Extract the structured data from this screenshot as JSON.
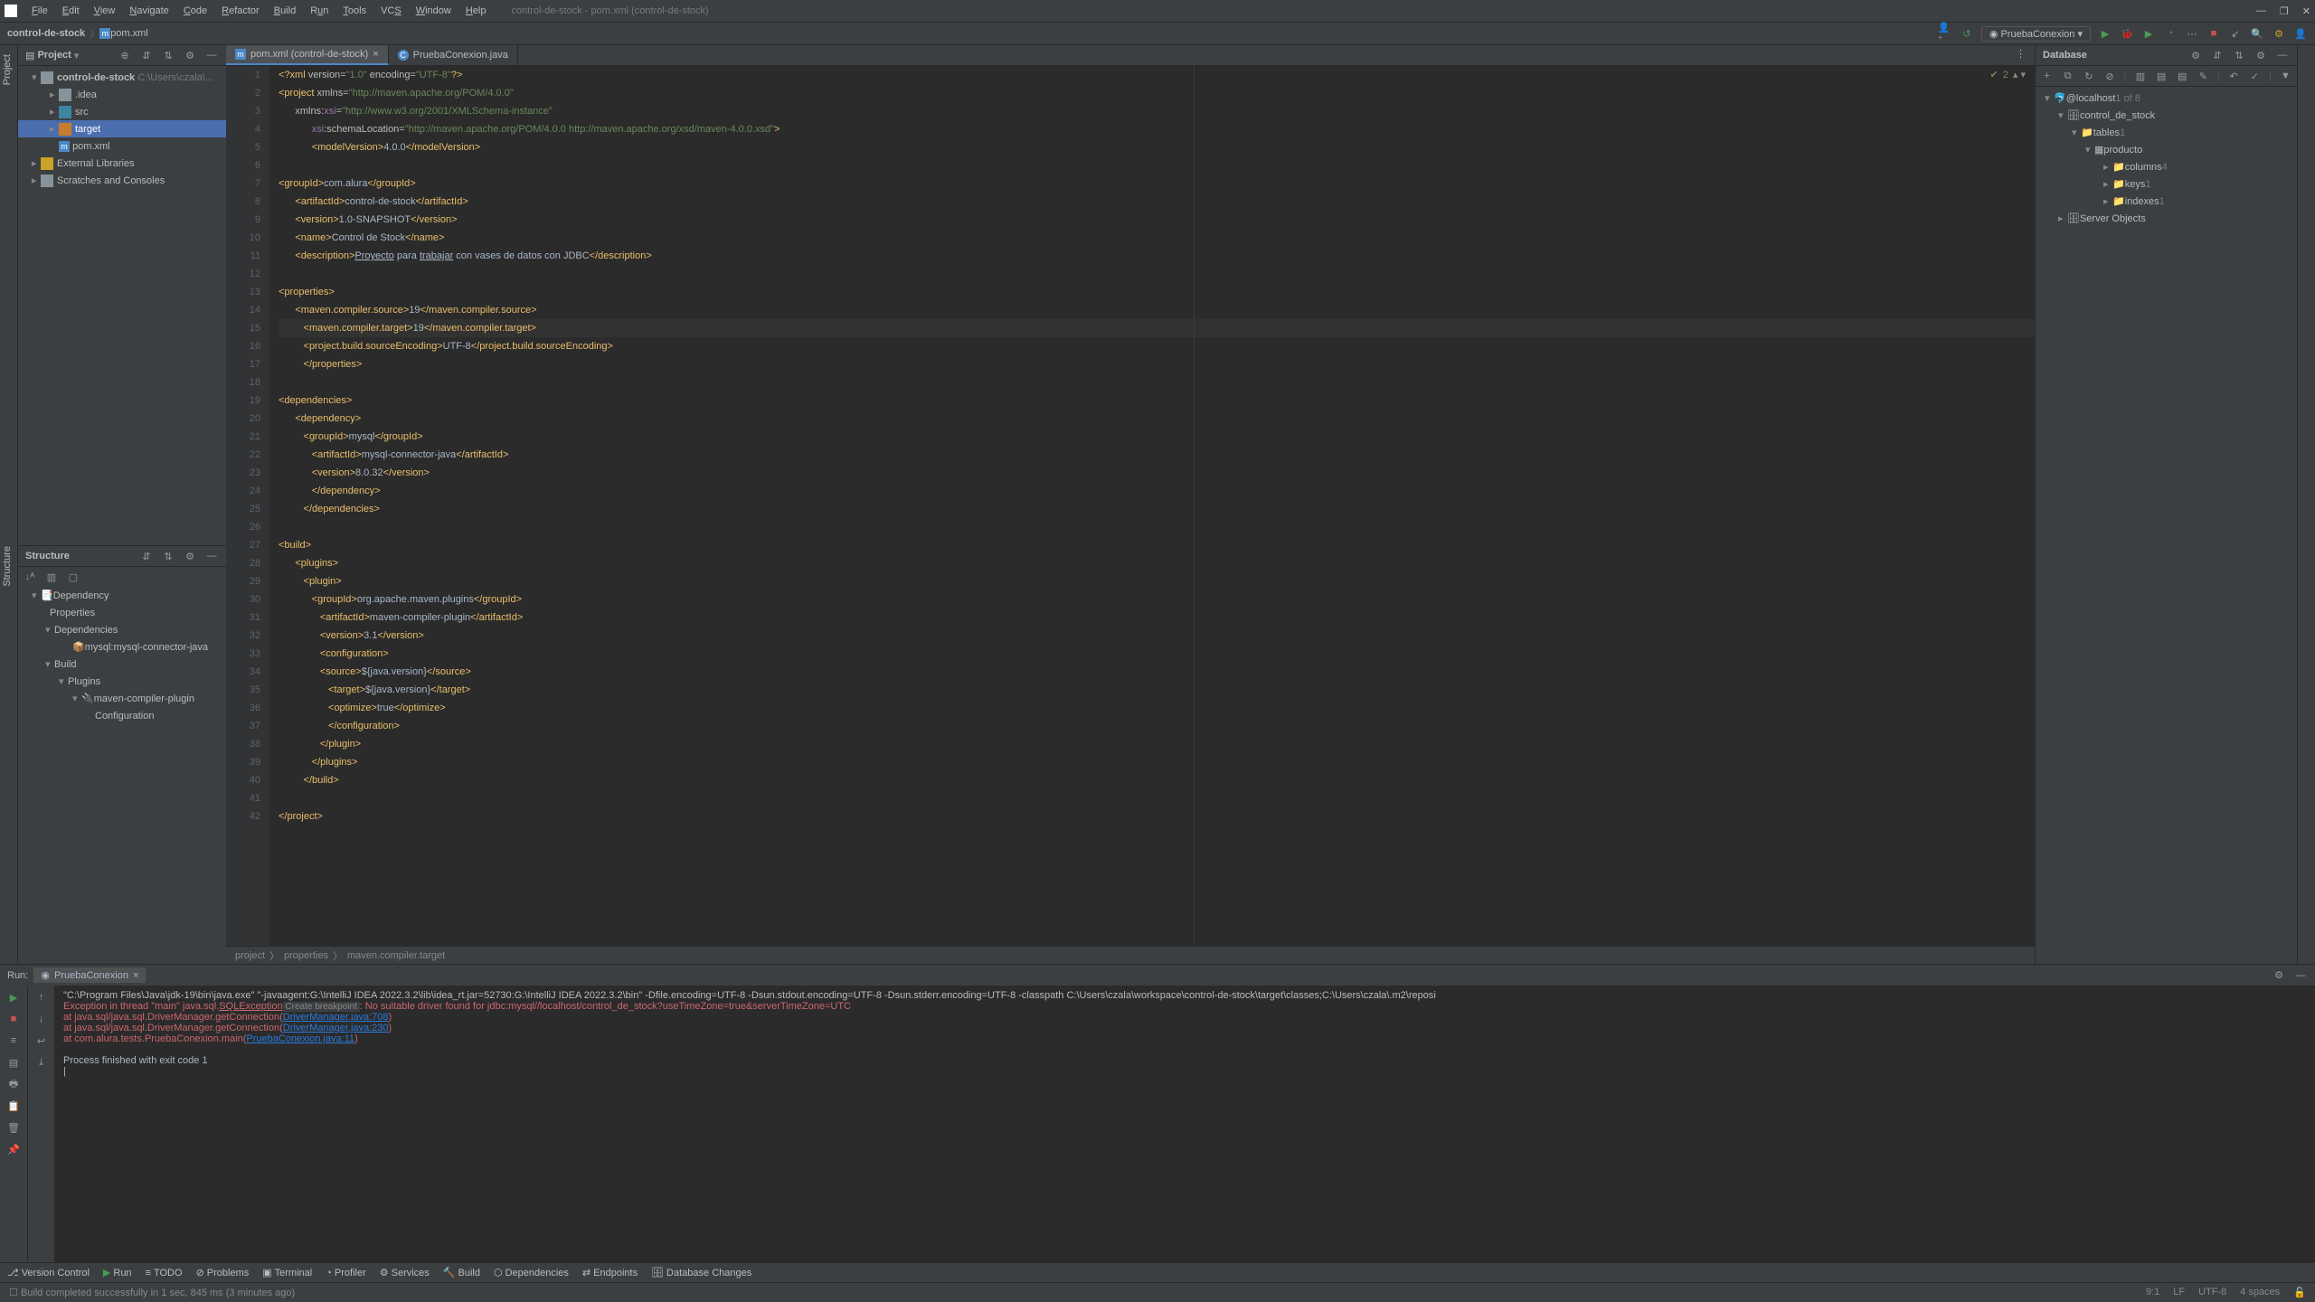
{
  "menu": [
    "File",
    "Edit",
    "View",
    "Navigate",
    "Code",
    "Refactor",
    "Build",
    "Run",
    "Tools",
    "VCS",
    "Window",
    "Help"
  ],
  "title_path": "control-de-stock - pom.xml (control-de-stock)",
  "toolbar": {
    "crumb1": "control-de-stock",
    "crumb2": "pom.xml",
    "run_config": "PruebaConexion"
  },
  "project": {
    "header": "Project",
    "root": "control-de-stock",
    "root_path": "C:\\Users\\czala\\...",
    "items": [
      ".idea",
      "src",
      "target",
      "pom.xml",
      "External Libraries",
      "Scratches and Consoles"
    ]
  },
  "structure": {
    "header": "Structure",
    "items": [
      "Dependency",
      "Properties",
      "Dependencies",
      "mysql:mysql-connector-java",
      "Build",
      "Plugins",
      "maven-compiler-plugin",
      "Configuration"
    ]
  },
  "tabs": {
    "pom": "pom.xml (control-de-stock)",
    "java": "PruebaConexion.java"
  },
  "breadcrumbs": [
    "project",
    "properties",
    "maven.compiler.target"
  ],
  "database": {
    "header": "Database",
    "host": "@localhost",
    "host_meta": "1 of 8",
    "schema": "control_de_stock",
    "tables": "tables",
    "tables_count": "1",
    "table": "producto",
    "columns": "columns",
    "columns_count": "4",
    "keys": "keys",
    "keys_count": "1",
    "indexes": "indexes",
    "indexes_count": "1",
    "server_objects": "Server Objects"
  },
  "run": {
    "header": "Run:",
    "tab": "PruebaConexion",
    "cmd": "\"C:\\Program Files\\Java\\jdk-19\\bin\\java.exe\" \"-javaagent:G:\\IntelliJ IDEA 2022.3.2\\lib\\idea_rt.jar=52730:G:\\IntelliJ IDEA 2022.3.2\\bin\" -Dfile.encoding=UTF-8 -Dsun.stdout.encoding=UTF-8 -Dsun.stderr.encoding=UTF-8 -classpath C:\\Users\\czala\\workspace\\control-de-stock\\target\\classes;C:\\Users\\czala\\.m2\\reposi",
    "exc_prefix": "Exception in thread \"main\" java.sql.",
    "exc_class": "SQLException",
    "exc_bp": " Create breakpoint ",
    "exc_msg": ": No suitable driver found for jdbc:mysql//localhost/control_de_stock?useTimeZone=true&serverTimeZone=UTC",
    "trace1": "    at java.sql/java.sql.DriverManager.getConnection(",
    "trace1_link": "DriverManager.java:708",
    "trace1_end": ")",
    "trace2": "    at java.sql/java.sql.DriverManager.getConnection(",
    "trace2_link": "DriverManager.java:230",
    "trace2_end": ")",
    "trace3": "    at com.alura.tests.PruebaConexion.main(",
    "trace3_link": "PruebaConexion.java:11",
    "trace3_end": ")",
    "exit": "Process finished with exit code 1"
  },
  "bottom": {
    "vc": "Version Control",
    "run": "Run",
    "todo": "TODO",
    "problems": "Problems",
    "terminal": "Terminal",
    "profiler": "Profiler",
    "services": "Services",
    "build": "Build",
    "deps": "Dependencies",
    "endpoints": "Endpoints",
    "dbchanges": "Database Changes"
  },
  "status": {
    "msg": "Build completed successfully in 1 sec, 845 ms (3 minutes ago)",
    "pos": "9:1",
    "lf": "LF",
    "enc": "UTF-8",
    "indent": "4 spaces",
    "branch": ""
  },
  "code_validation": "2",
  "indents": [
    0,
    0,
    2,
    4,
    4,
    2,
    0,
    2,
    2,
    2,
    2,
    2,
    0,
    2,
    3,
    3,
    3,
    2,
    0,
    2,
    3,
    4,
    4,
    4,
    3,
    2,
    0,
    2,
    3,
    4,
    5,
    5,
    5,
    5,
    6,
    6,
    6,
    5,
    4,
    3,
    2,
    0,
    0
  ]
}
